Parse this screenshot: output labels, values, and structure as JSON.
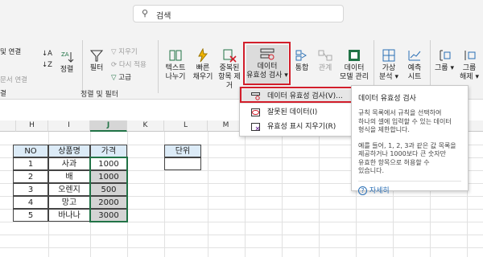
{
  "search": {
    "placeholder": "검색"
  },
  "ribbon": {
    "left_items": {
      "connections_label": "및 연결",
      "doc_connections_label": "문서 연결",
      "edit_label": "결"
    },
    "sort_label": "정렬",
    "filter_label": "필터",
    "clear_label": "지우기",
    "reapply_label": "다시 적용",
    "advanced_label": "고급",
    "group_sort_filter": "정렬 및 필터",
    "text_to_columns": [
      "텍스트",
      "나누기"
    ],
    "flash_fill": [
      "빠른",
      "채우기"
    ],
    "remove_duplicates": [
      "중복된",
      "항목 제거"
    ],
    "data_validation": [
      "데이터",
      "유효성 검사"
    ],
    "consolidate_label": "통합",
    "relationships_label": "관계",
    "data_model": [
      "데이터",
      "모델 관리"
    ],
    "what_if": [
      "가상",
      "분석"
    ],
    "forecast": [
      "예측",
      "시트"
    ],
    "group": [
      "그룹"
    ],
    "ungroup": [
      "그룹",
      "해제"
    ]
  },
  "menu": {
    "items": [
      {
        "label": "데이터 유효성 검사(V)...",
        "icon": "data-validation-icon"
      },
      {
        "label": "잘못된 데이터(I)",
        "icon": "circle-invalid-icon"
      },
      {
        "label": "유효성 표시 지우기(R)",
        "icon": "clear-circles-icon"
      }
    ]
  },
  "tooltip": {
    "title": "데이터 유효성 검사",
    "lines1": [
      "규칙 목록에서 규칙을 선택하여",
      "하나의 셀에 입력할 수 있는 데이터",
      "형식을 제한합니다."
    ],
    "lines2": [
      "예를 들어, 1, 2, 3과 같은 값 목록을",
      "제공하거나 1000보다 큰 숫자만",
      "유효한 항목으로 허용할 수",
      "있습니다."
    ],
    "more_label": "자세히"
  },
  "columns": [
    "H",
    "I",
    "J",
    "K",
    "L",
    "M"
  ],
  "selected_column": "J",
  "table": {
    "headers": [
      "NO",
      "상품명",
      "가격"
    ],
    "rows": [
      [
        "1",
        "사과",
        "1000"
      ],
      [
        "2",
        "배",
        "1000"
      ],
      [
        "3",
        "오렌지",
        "500"
      ],
      [
        "4",
        "망고",
        "2000"
      ],
      [
        "5",
        "바나나",
        "3000"
      ]
    ]
  },
  "unit_header": "단위",
  "colors": {
    "excel_green": "#217346",
    "highlight_red": "#d21e2b",
    "header_fill": "#dcebf7",
    "selected_fill": "#d4d4d4"
  }
}
